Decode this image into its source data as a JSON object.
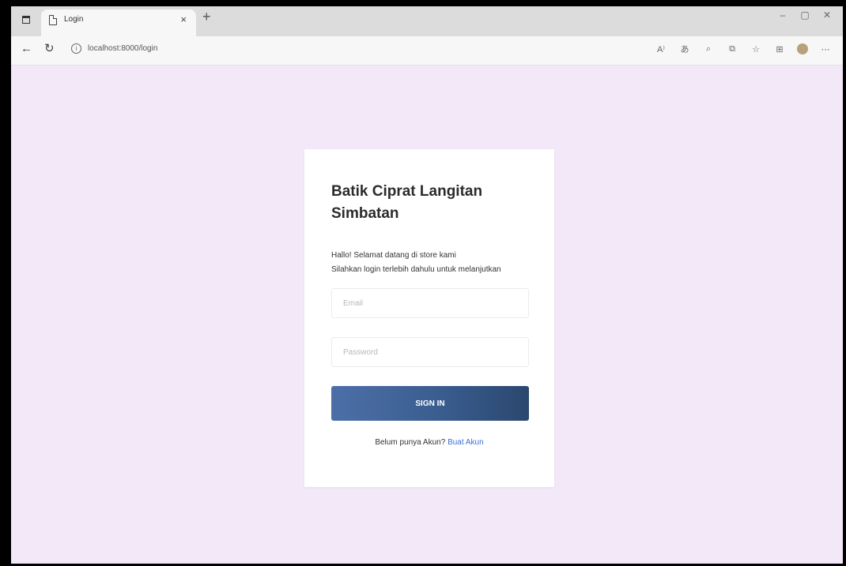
{
  "browser": {
    "tab_title": "Login",
    "tab_close": "×",
    "new_tab": "+",
    "url": "localhost:8000/login",
    "window_controls": [
      "–",
      "▢",
      "✕"
    ],
    "toolbar_icons": [
      "read-aloud-icon",
      "translate-icon",
      "zoom-icon",
      "extensions-icon",
      "favorites-icon",
      "collections-icon",
      "profile-icon",
      "more-icon"
    ],
    "toolbar_glyphs": [
      "A⁾",
      "あ",
      "⌕",
      "⧉",
      "☆",
      "⊞",
      "",
      "⋯"
    ]
  },
  "login": {
    "title": "Batik Ciprat Langitan Simbatan",
    "greeting_line1": "Hallo! Selamat datang di store kami",
    "greeting_line2": "Silahkan login terlebih dahulu untuk melanjutkan",
    "email_placeholder": "Email",
    "password_placeholder": "Password",
    "signin_label": "SIGN IN",
    "register_prompt": "Belum punya Akun?",
    "register_link": "Buat Akun"
  },
  "colors": {
    "background": "#f3e8f7",
    "button": "#3a5d8f",
    "link": "#3b6fd6"
  }
}
